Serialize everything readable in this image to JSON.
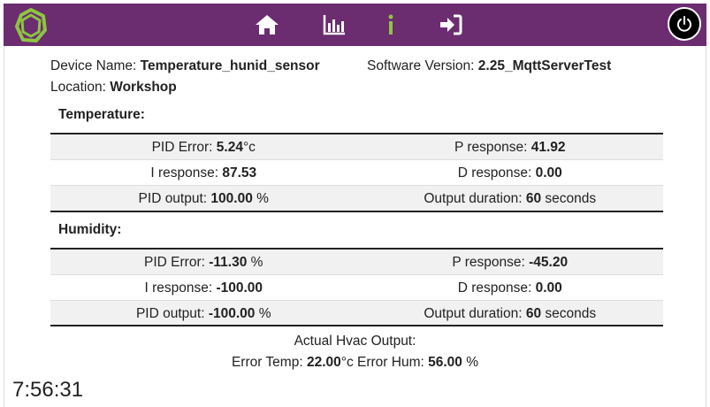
{
  "nav": {
    "icons": [
      "home-icon",
      "bar-chart-icon",
      "info-icon",
      "sign-in-icon"
    ],
    "power_icon": "power-icon",
    "brand_color": "#6b2c70",
    "logo_color": "#8cc63f"
  },
  "device": {
    "name_label": "Device Name:",
    "name_value": "Temperature_hunid_sensor",
    "location_label": "Location:",
    "location_value": "Workshop",
    "software_label": "Software Version:",
    "software_value": "2.25_MqttServerTest"
  },
  "temperature": {
    "title": "Temperature:",
    "pid_error_label": "PID Error:",
    "pid_error_value": "5.24",
    "pid_error_unit": "°c",
    "p_label": "P response:",
    "p_value": "41.92",
    "i_label": "I response:",
    "i_value": "87.53",
    "d_label": "D response:",
    "d_value": "0.00",
    "output_label": "PID output:",
    "output_value": "100.00",
    "output_unit": "%",
    "duration_label": "Output duration:",
    "duration_value": "60",
    "duration_unit": "seconds"
  },
  "humidity": {
    "title": "Humidity:",
    "pid_error_label": "PID Error:",
    "pid_error_value": "-11.30",
    "pid_error_unit": "%",
    "p_label": "P response:",
    "p_value": "-45.20",
    "i_label": "I response:",
    "i_value": "-100.00",
    "d_label": "D response:",
    "d_value": "0.00",
    "output_label": "PID output:",
    "output_value": "-100.00",
    "output_unit": "%",
    "duration_label": "Output duration:",
    "duration_value": "60",
    "duration_unit": "seconds"
  },
  "hvac": {
    "title": "Actual Hvac Output:",
    "error_temp_label": "Error Temp:",
    "error_temp_value": "22.00",
    "error_temp_unit": "°c",
    "error_hum_label": "Error Hum:",
    "error_hum_value": "56.00",
    "error_hum_unit": "%"
  },
  "clock": "7:56:31"
}
